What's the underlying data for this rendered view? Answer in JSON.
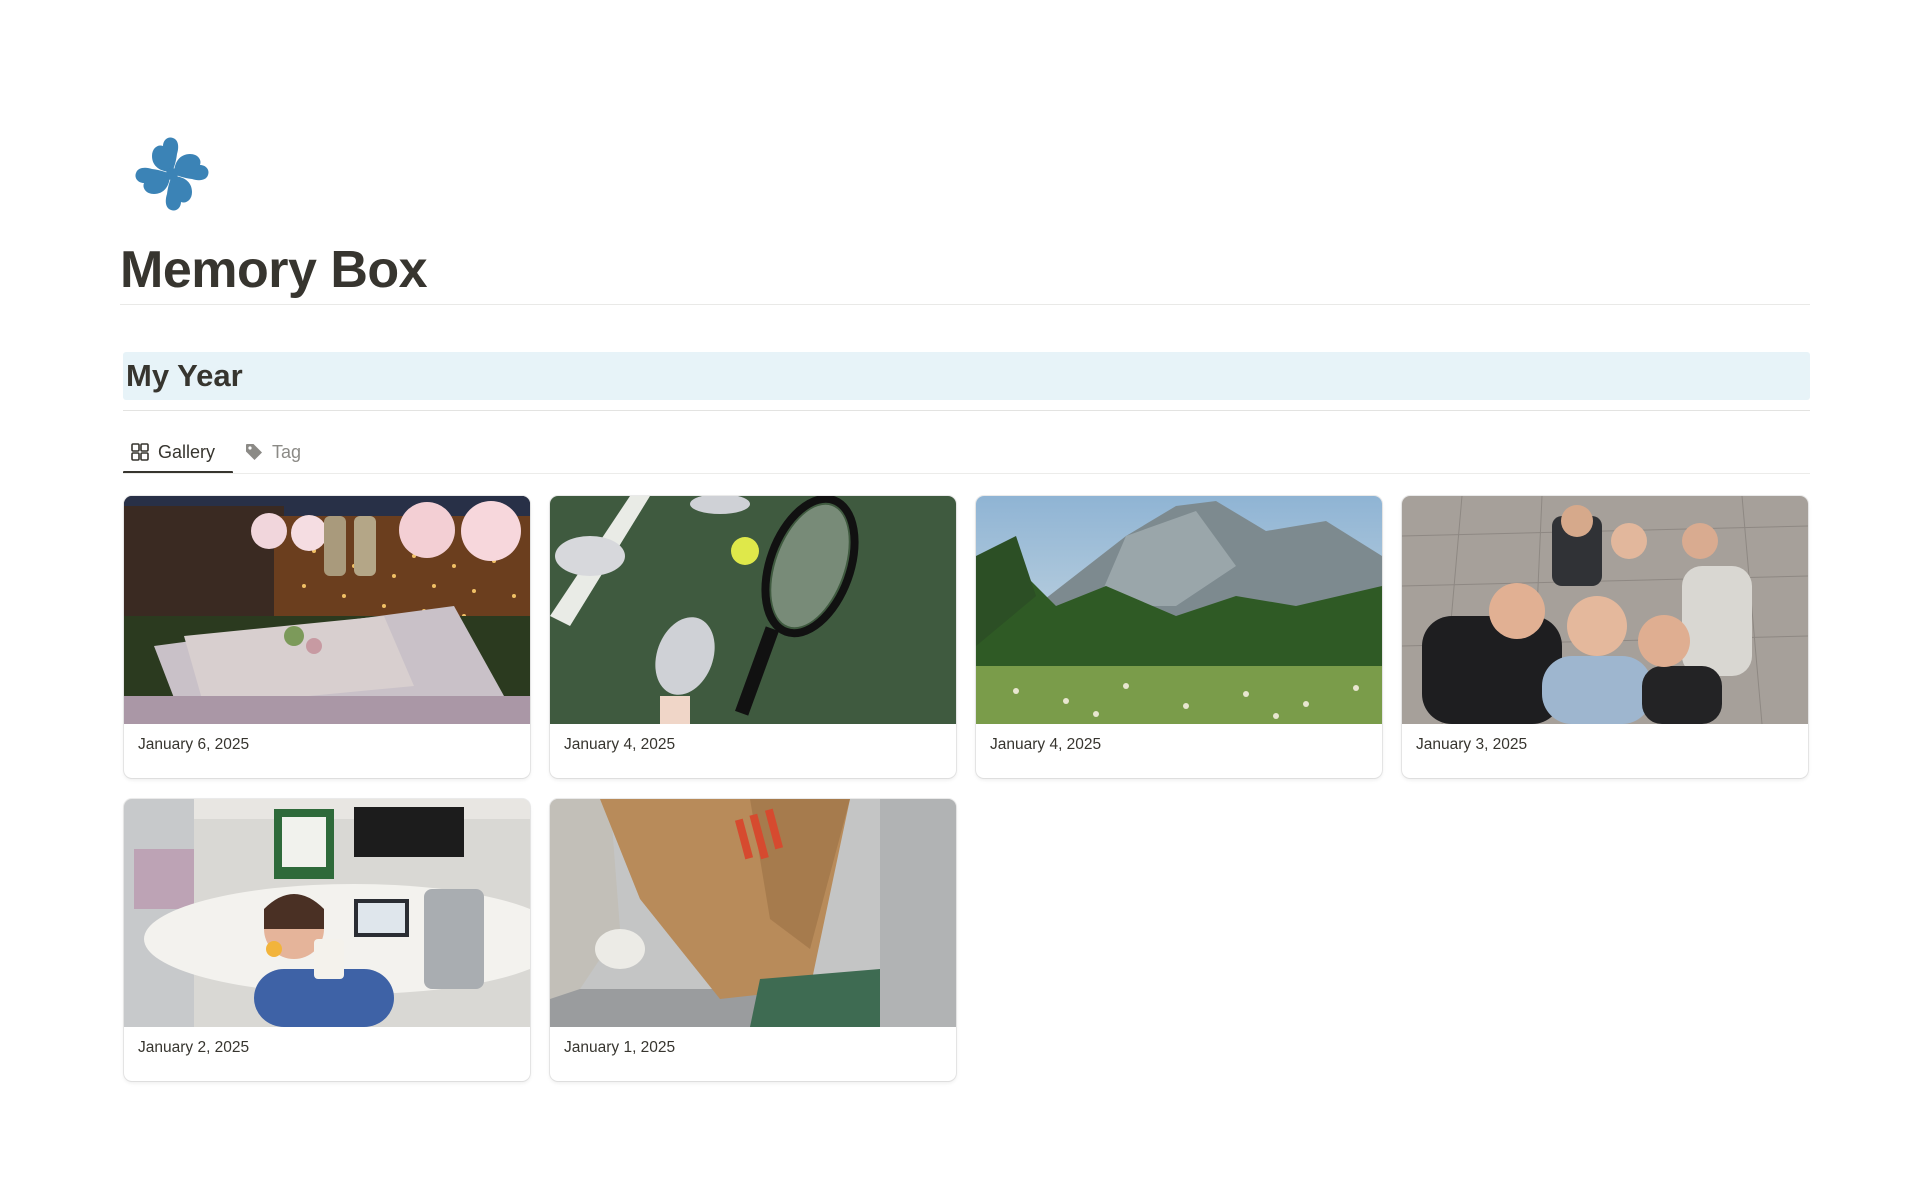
{
  "page": {
    "icon": "four-leaf-clover-icon",
    "icon_color": "#3b83b6",
    "title": "Memory Box"
  },
  "callout": {
    "text": "My Year",
    "background": "#e7f3f8"
  },
  "views": [
    {
      "label": "Gallery",
      "icon": "gallery-grid-icon",
      "active": true
    },
    {
      "label": "Tag",
      "icon": "tag-icon",
      "active": false
    }
  ],
  "gallery": {
    "cards": [
      {
        "date": "January 6, 2025",
        "image": "birthday-picnic-photo"
      },
      {
        "date": "January 4, 2025",
        "image": "tennis-court-photo"
      },
      {
        "date": "January 4, 2025",
        "image": "mountain-meadow-photo"
      },
      {
        "date": "January 3, 2025",
        "image": "friends-selfie-photo"
      },
      {
        "date": "January 2, 2025",
        "image": "office-coffee-photo"
      },
      {
        "date": "January 1, 2025",
        "image": "shopping-bag-photo"
      }
    ]
  }
}
